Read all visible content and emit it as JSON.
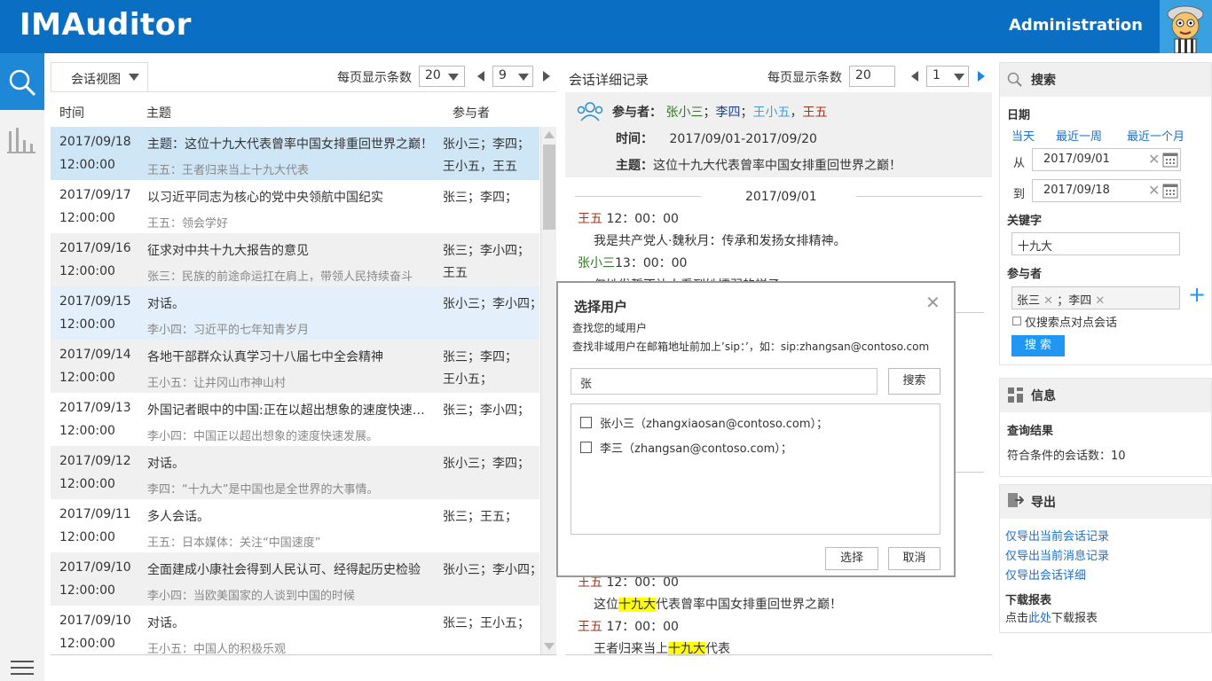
{
  "app": {
    "title": "IMAuditor",
    "admin": "Administration"
  },
  "list": {
    "view_label": "会话视图",
    "per_page_label": "每页显示条数",
    "per_page": "20",
    "page": "9",
    "columns": {
      "time": "时间",
      "subject": "主题",
      "participants": "参与者"
    },
    "rows": [
      {
        "date": "2017/09/18",
        "time": "12:00:00",
        "subject_prefix": "主题：",
        "subject": "这位十九大代表曾率中国女排重回世界之巅！",
        "sub": "王五：王者归来当上十九大代表",
        "p1": "张小三；李四；",
        "p2": "王小五，王五"
      },
      {
        "date": "2017/09/17",
        "time": "12:00:00",
        "subject": "以习近平同志为核心的党中央领航中国纪实",
        "sub": "王五：领会学好",
        "p1": "张三；李四；",
        "p2": ""
      },
      {
        "date": "2017/09/16",
        "time": "12:00:00",
        "subject": "征求对中共十九大报告的意见",
        "sub": "张三：民族的前途命运扛在肩上，带领人民持续奋斗",
        "p1": "张三；李小四；",
        "p2": "王五"
      },
      {
        "date": "2017/09/15",
        "time": "12:00:00",
        "subject": "对话。",
        "sub": "李小四：习近平的七年知青岁月",
        "p1": "张小三；李小四；",
        "p2": ""
      },
      {
        "date": "2017/09/14",
        "time": "12:00:00",
        "subject": "各地干部群众认真学习十八届七中全会精神",
        "sub": "王小五：让井冈山市神山村",
        "p1": "张三；李四；",
        "p2": "王小五；"
      },
      {
        "date": "2017/09/13",
        "time": "12:00:00",
        "subject": "外国记者眼中的中国:正在以超出想象的速度快速发展",
        "sub": "李小四：中国正以超出想象的速度快速发展。",
        "p1": "张三；李小四；",
        "p2": ""
      },
      {
        "date": "2017/09/12",
        "time": "12:00:00",
        "subject": "对话。",
        "sub": "李四：“十九大”是中国也是全世界的大事情。",
        "p1": "张小三；李四；",
        "p2": ""
      },
      {
        "date": "2017/09/11",
        "time": "12:00:00",
        "subject": "多人会话。",
        "sub": "王五：日本媒体：关注“中国速度”",
        "p1": "张三；王五；",
        "p2": ""
      },
      {
        "date": "2017/09/10",
        "time": "12:00:00",
        "subject": "全面建成小康社会得到人民认可、经得起历史检验",
        "sub": "李小四：当欧美国家的人谈到中国的时候",
        "p1": "张小三；李小四；",
        "p2": ""
      },
      {
        "date": "2017/09/10",
        "time": "12:00:00",
        "subject": "对话。",
        "sub": "王小五：中国人的积极乐观",
        "p1": "张三；王小五；",
        "p2": ""
      }
    ]
  },
  "detail": {
    "title": "会话详细记录",
    "per_page_label": "每页显示条数",
    "per_page": "20",
    "page": "1",
    "participants_label": "参与者：",
    "participants": [
      "张小三",
      "李四",
      "王小五",
      "王五"
    ],
    "time_label": "时间：",
    "time_value": "2017/09/01-2017/09/20",
    "subject_label": "主题：",
    "subject_value": "这位十九大代表曾率中国女排重回世界之巅！",
    "date_divider": "2017/09/01",
    "msg1_name": "王五",
    "msg1_time": "12：00：00",
    "msg1_text": "我是共产党人·魏秋月：传承和发扬女排精神。",
    "msg2_name": "张小三",
    "msg2_time": "13：00：00",
    "msg2_text": "仅她发誓不让人看到她懦弱的样子",
    "msg3_name": "王五",
    "msg3_time": "12：00：00",
    "msg3_pre": "这位",
    "msg3_hl": "十九大",
    "msg3_post": "代表曾率中国女排重回世界之巅！",
    "msg4_name": "王五",
    "msg4_time": "17：00：00",
    "msg4_pre": "王者归来当上",
    "msg4_hl": "十九大",
    "msg4_post": "代表"
  },
  "search": {
    "title": "搜索",
    "date_label": "日期",
    "today": "当天",
    "last_week": "最近一周",
    "last_month": "最近一个月",
    "from_label": "从",
    "from_value": "2017/09/01",
    "to_label": "到",
    "to_value": "2017/09/18",
    "keyword_label": "关键字",
    "keyword_value": "十九大",
    "participants_label": "参与者",
    "tag1": "张三",
    "tag_sep": "；",
    "tag2": "李四",
    "p2p_only": "仅搜索点对点会话",
    "button": "搜 索"
  },
  "info": {
    "title": "信息",
    "result_label": "查询结果",
    "count_text": "符合条件的会话数：10"
  },
  "export": {
    "title": "导出",
    "link1": "仅导出当前会话记录",
    "link2": "仅导出当前消息记录",
    "link3": "仅导出会话详细",
    "report_label": "下载报表",
    "report_pre": "点击",
    "report_link": "此处",
    "report_post": "下载报表"
  },
  "modal": {
    "title": "选择用户",
    "line1": "查找您的域用户",
    "line2": "查找非域用户在邮箱地址前加上’sip：’，如：sip:zhangsan@contoso.com",
    "input_value": "张",
    "search_button": "搜索",
    "results": [
      "张小三（zhangxiaosan@contoso.com）；",
      "李三（zhangsan@contoso.com）；"
    ],
    "select_button": "选择",
    "cancel_button": "取消"
  }
}
